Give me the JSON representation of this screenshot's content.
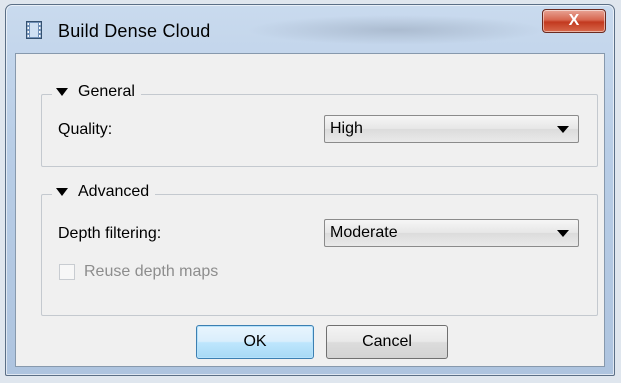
{
  "window": {
    "title": "Build Dense Cloud",
    "icon": "film-strip-icon",
    "close_label": "X"
  },
  "general": {
    "heading": "General",
    "quality_label": "Quality:",
    "quality_value": "High"
  },
  "advanced": {
    "heading": "Advanced",
    "depth_filtering_label": "Depth filtering:",
    "depth_filtering_value": "Moderate",
    "reuse_depth_maps_label": "Reuse depth maps",
    "reuse_depth_maps_checked": false,
    "reuse_depth_maps_enabled": false
  },
  "buttons": {
    "ok": "OK",
    "cancel": "Cancel"
  },
  "colors": {
    "default_button_border": "#3c7fb1",
    "close_button": "#c2391f",
    "disabled_text": "#8d8d8d"
  }
}
